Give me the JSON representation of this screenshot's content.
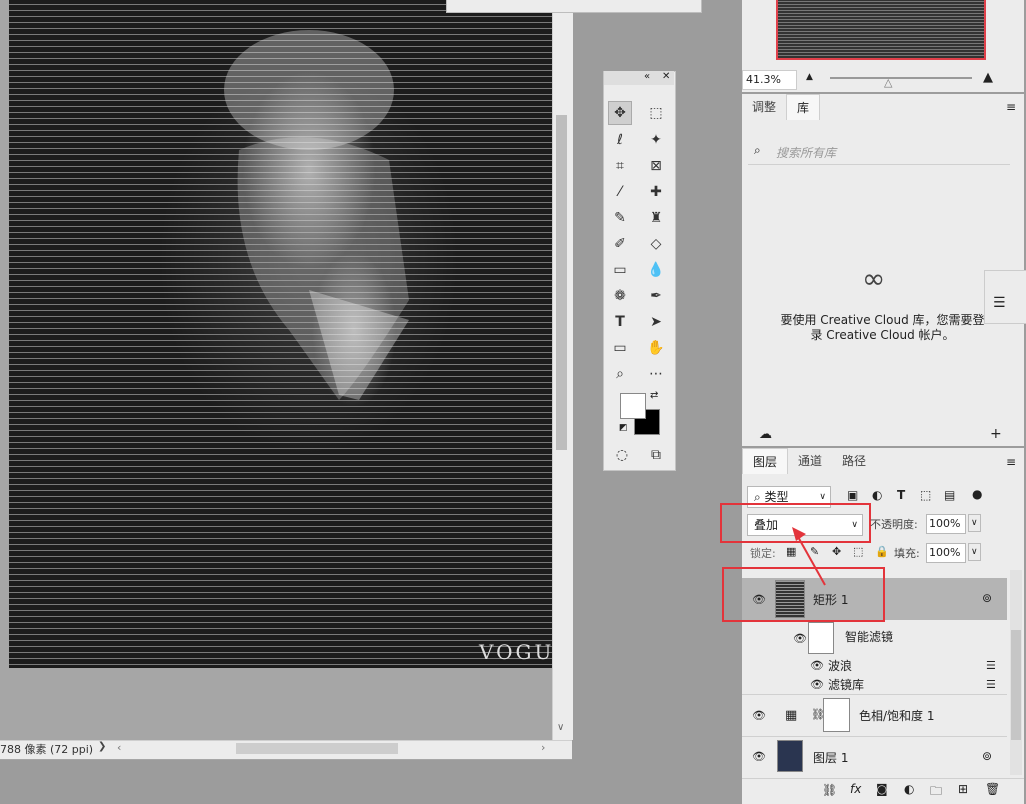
{
  "canvas": {
    "watermark": "VOGUE"
  },
  "status": {
    "text": "788 像素 (72 ppi)",
    "arrow": "❯"
  },
  "navigator": {
    "zoom": "41.3%"
  },
  "library": {
    "tabs": [
      {
        "label": "调整"
      },
      {
        "label": "库"
      }
    ],
    "search_placeholder": "搜索所有库",
    "message_line1": "要使用 Creative Cloud 库，您需要登",
    "message_line2": "录 Creative Cloud 帐户。"
  },
  "layers": {
    "tabs": [
      {
        "label": "图层"
      },
      {
        "label": "通道"
      },
      {
        "label": "路径"
      }
    ],
    "filter_label": "类型",
    "blend_mode": "叠加",
    "opacity_label": "不透明度:",
    "opacity_value": "100%",
    "lock_label": "锁定:",
    "fill_label": "填充:",
    "fill_value": "100%",
    "items": [
      {
        "name": "矩形 1"
      },
      {
        "name": "智能滤镜"
      },
      {
        "name": "波浪"
      },
      {
        "name": "滤镜库"
      },
      {
        "name": "色相/饱和度 1"
      },
      {
        "name": "图层 1"
      }
    ]
  },
  "colors": {
    "highlight": "#e3343b"
  }
}
